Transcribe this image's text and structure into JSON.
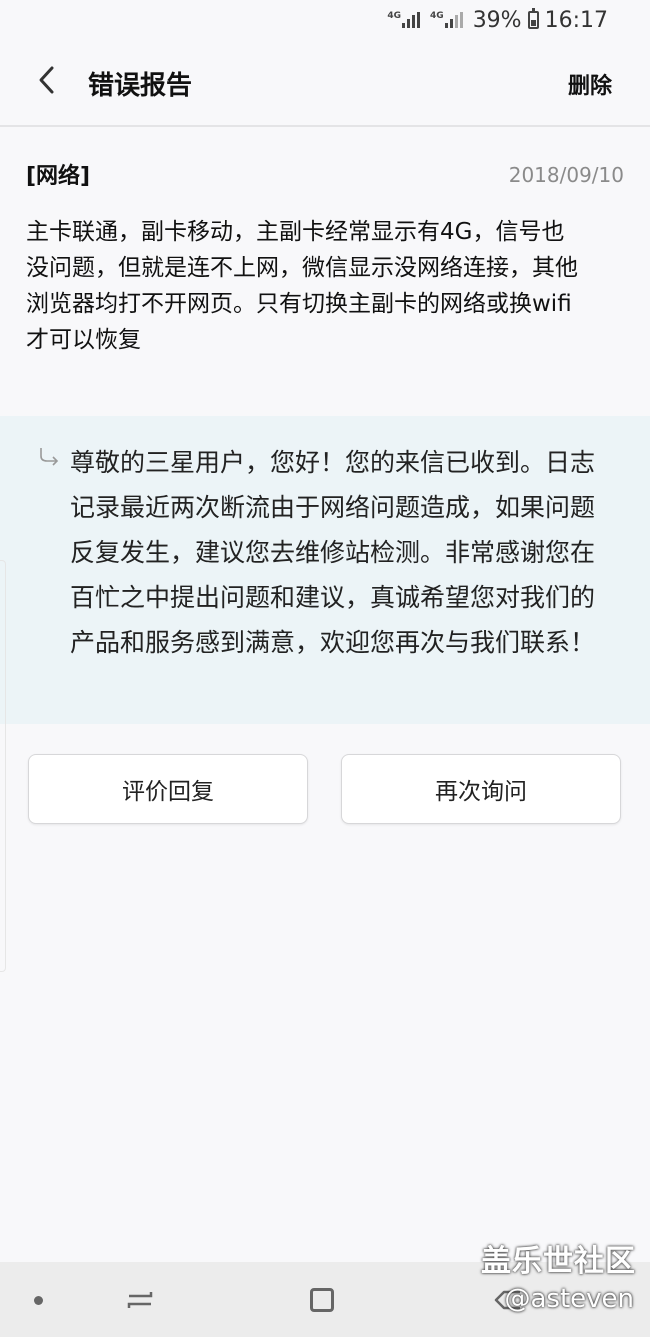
{
  "status": {
    "sim1": "4G",
    "sim2": "4G",
    "battery": "39%",
    "time": "16:17"
  },
  "header": {
    "title": "错误报告",
    "delete_label": "删除"
  },
  "report": {
    "category": "[网络]",
    "date": "2018/09/10",
    "body": "主卡联通，副卡移动，主副卡经常显示有4G，信号也没问题，但就是连不上网，微信显示没网络连接，其他浏览器均打不开网页。只有切换主副卡的网络或换wifi才可以恢复"
  },
  "reply": {
    "text": "尊敬的三星用户，您好！您的来信已收到。日志记录最近两次断流由于网络问题造成，如果问题反复发生，建议您去维修站检测。非常感谢您在百忙之中提出问题和建议，真诚希望您对我们的产品和服务感到满意，欢迎您再次与我们联系！"
  },
  "actions": {
    "rate_label": "评价回复",
    "ask_again_label": "再次询问"
  },
  "watermark": {
    "site": "盖乐世社区",
    "user": "@asteven"
  },
  "colors": {
    "reply_bg": "#ecf4f7",
    "page_bg": "#f8f8fa",
    "nav_bg": "#ececec"
  },
  "icons": [
    "back-icon",
    "reply-arrow-icon",
    "nav-recent-icon",
    "nav-home-icon",
    "nav-back-icon",
    "battery-icon",
    "signal-icon"
  ]
}
